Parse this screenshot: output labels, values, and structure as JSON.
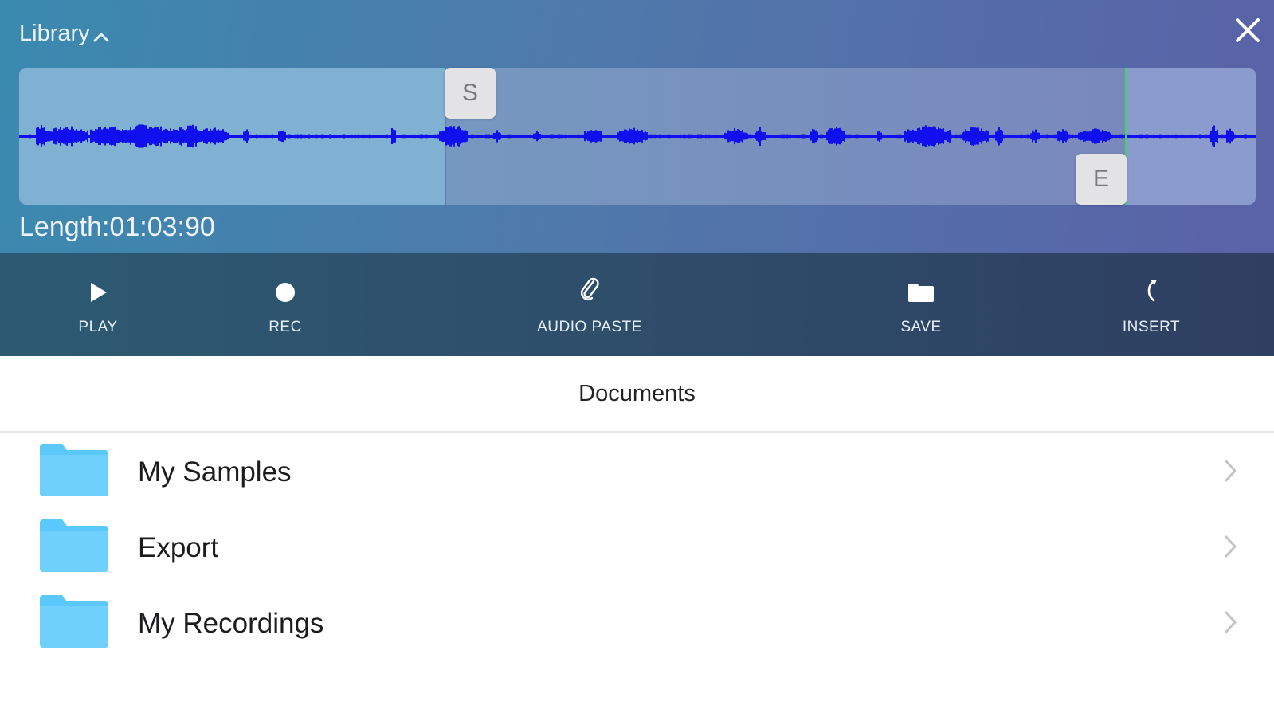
{
  "header": {
    "library_label": "Library",
    "length_label": "Length:01:03:90",
    "start_handle": "S",
    "end_handle": "E"
  },
  "toolbar": {
    "play": "PLAY",
    "rec": "REC",
    "audio_paste": "AUDIO PASTE",
    "save": "SAVE",
    "insert": "INSERT"
  },
  "documents": {
    "title": "Documents",
    "folders": [
      {
        "name": "My Samples"
      },
      {
        "name": "Export"
      },
      {
        "name": "My Recordings"
      }
    ]
  },
  "colors": {
    "waveform": "#1010ee",
    "end_marker": "#3fd46a",
    "folder": "#5ac8fa"
  }
}
